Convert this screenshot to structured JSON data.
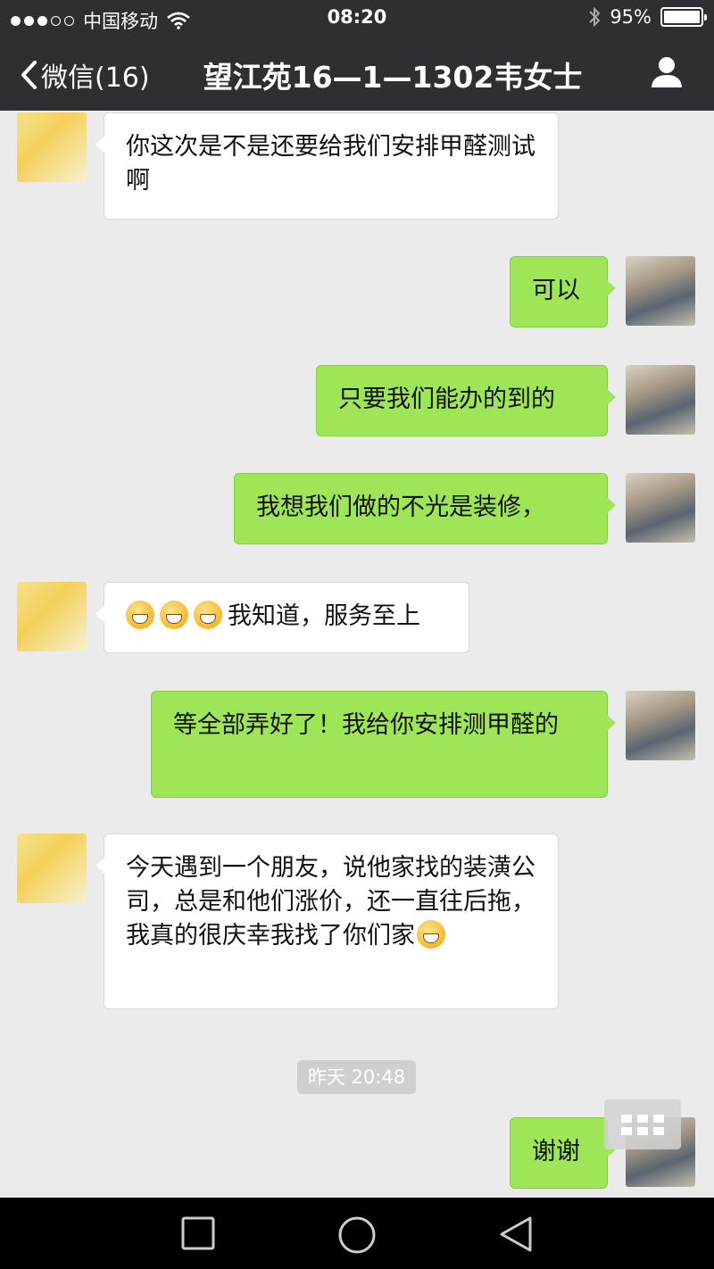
{
  "status_bar": {
    "carrier": "中国移动",
    "time": "08:20",
    "battery": "95%"
  },
  "nav": {
    "back_label": "微信(16)",
    "title": "望江苑16—1—1302韦女士"
  },
  "messages": [
    {
      "direction": "in",
      "text": "你这次是不是还要给我们安排甲醛测试啊"
    },
    {
      "direction": "out",
      "text": "可以"
    },
    {
      "direction": "out",
      "text": "只要我们能办的到的"
    },
    {
      "direction": "out",
      "text": "我想我们做的不光是装修，"
    },
    {
      "direction": "in",
      "emoji_count": 3,
      "emoji": "grin-emoji",
      "text": "我知道，服务至上"
    },
    {
      "direction": "out",
      "text": "等全部弄好了！我给你安排测甲醛的"
    },
    {
      "direction": "in",
      "text": "今天遇到一个朋友，说他家找的装潢公司，总是和他们涨价，还一直往后拖，我真的很庆幸我找了你们家",
      "emoji": "thinking-emoji"
    },
    {
      "direction": "out",
      "text": "谢谢"
    }
  ],
  "timestamp": "昨天 20:48",
  "colors": {
    "nav_bg": "#2e2f33",
    "chat_bg": "#ebebeb",
    "out_bubble": "#9ee658",
    "in_bubble": "#ffffff"
  }
}
